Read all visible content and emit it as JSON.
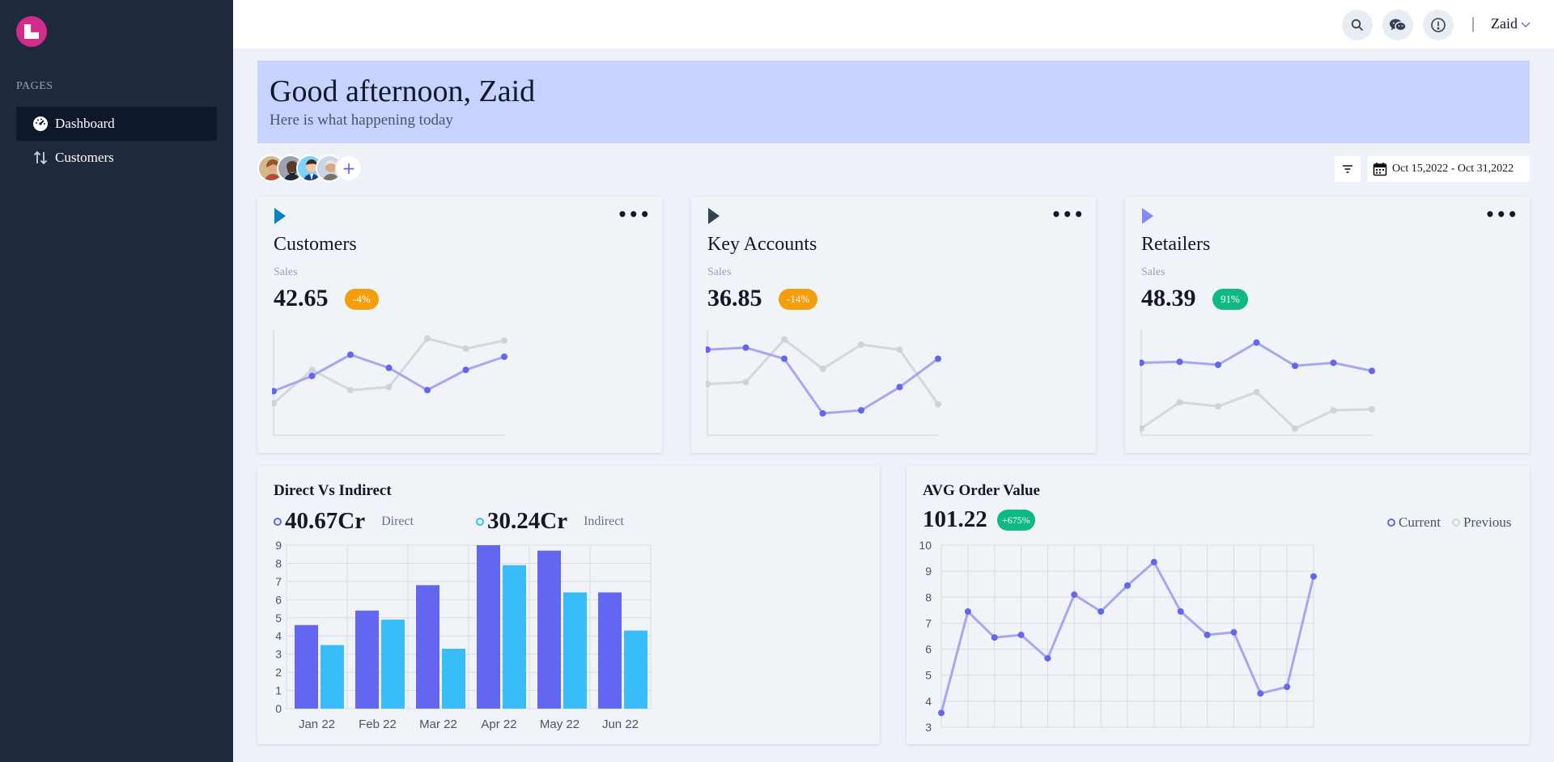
{
  "sidebar": {
    "section_label": "PAGES",
    "items": [
      {
        "label": "Dashboard"
      },
      {
        "label": "Customers"
      }
    ]
  },
  "topbar": {
    "user_name": "Zaid",
    "separator": "|"
  },
  "banner": {
    "greeting": "Good afternoon, Zaid",
    "subtitle": "Here is what happening today"
  },
  "toolbar": {
    "add_symbol": "+",
    "date_range": "Oct 15,2022 - Oct 31,2022"
  },
  "kpis": [
    {
      "title": "Customers",
      "subtitle": "Sales",
      "value": "42.65",
      "change": "-4%",
      "badge_color": "#f59e0b",
      "icon_color": "#0284c7",
      "current": [
        4.2,
        5.7,
        7.8,
        6.5,
        4.3,
        6.3,
        7.6
      ],
      "previous": [
        3.0,
        6.3,
        4.3,
        4.6,
        9.4,
        8.4,
        9.2
      ]
    },
    {
      "title": "Key Accounts",
      "subtitle": "Sales",
      "value": "36.85",
      "change": "-14%",
      "badge_color": "#f59e0b",
      "icon_color": "#334155",
      "current": [
        8.3,
        8.5,
        7.4,
        2.0,
        2.3,
        4.6,
        7.4
      ],
      "previous": [
        4.9,
        5.1,
        9.3,
        6.4,
        8.8,
        8.3,
        2.9
      ]
    },
    {
      "title": "Retailers",
      "subtitle": "Sales",
      "value": "48.39",
      "change": "91%",
      "badge_color": "#10b981",
      "icon_color": "#818cf8",
      "current": [
        7.0,
        7.1,
        6.8,
        9.0,
        6.7,
        7.0,
        6.2
      ],
      "previous": [
        0.5,
        3.1,
        2.7,
        4.1,
        0.5,
        2.3,
        2.4
      ]
    }
  ],
  "direct_vs_indirect": {
    "title": "Direct Vs Indirect",
    "direct_value": "40.67Cr",
    "direct_label": "Direct",
    "indirect_value": "30.24Cr",
    "indirect_label": "Indirect",
    "colors": {
      "direct": "#6366f1",
      "indirect": "#38bdf8"
    }
  },
  "avg_order": {
    "title": "AVG Order Value",
    "value": "101.22",
    "change": "+675%",
    "legend_current": "Current",
    "legend_previous": "Previous"
  },
  "chart_data": [
    {
      "type": "bar",
      "categories": [
        "Jan 22",
        "Feb 22",
        "Mar 22",
        "Apr 22",
        "May 22",
        "Jun 22"
      ],
      "series": [
        {
          "name": "Direct",
          "values": [
            4.6,
            5.4,
            6.8,
            9.0,
            8.7,
            6.4
          ]
        },
        {
          "name": "Indirect",
          "values": [
            3.5,
            4.9,
            3.3,
            7.9,
            6.4,
            4.3
          ]
        }
      ],
      "ylim": [
        0,
        9
      ],
      "yticks": [
        "0",
        "1",
        "2",
        "3",
        "4",
        "5",
        "6",
        "7",
        "8",
        "9"
      ],
      "grid": true
    },
    {
      "type": "line",
      "x": [
        "1",
        "2",
        "3",
        "4",
        "5",
        "6",
        "7",
        "8",
        "9",
        "10",
        "11",
        "12",
        "13",
        "14",
        "15"
      ],
      "series": [
        {
          "name": "Current",
          "values": [
            3.55,
            7.45,
            6.45,
            6.55,
            5.65,
            8.1,
            7.45,
            8.45,
            9.35,
            7.45,
            6.55,
            6.65,
            4.3,
            4.55,
            8.8
          ]
        }
      ],
      "ylim": [
        3,
        10
      ],
      "yticks": [
        "3",
        "4",
        "5",
        "6",
        "7",
        "8",
        "9",
        "10"
      ],
      "grid": true
    }
  ]
}
